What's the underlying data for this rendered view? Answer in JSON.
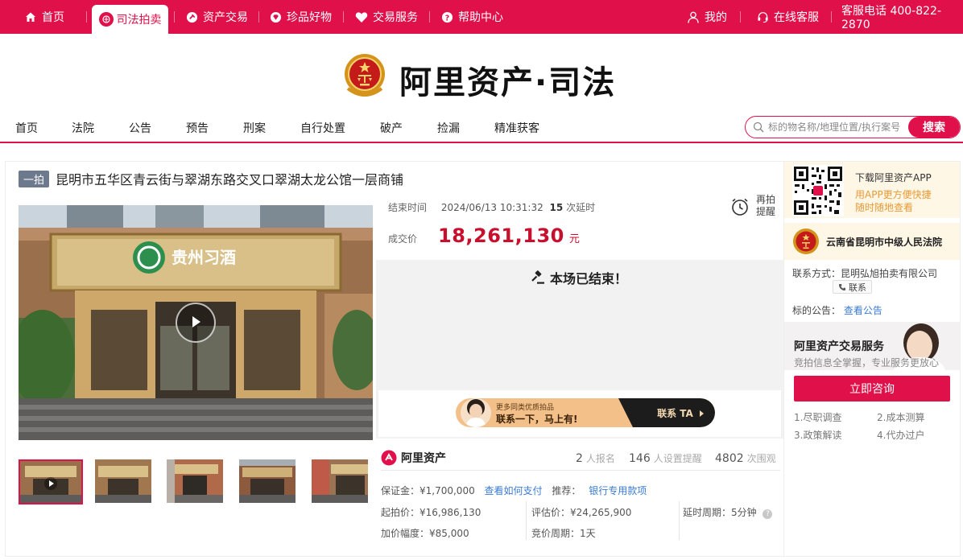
{
  "topbar": {
    "items": [
      {
        "label": "首页"
      },
      {
        "label": "司法拍卖"
      },
      {
        "label": "资产交易"
      },
      {
        "label": "珍品好物"
      },
      {
        "label": "交易服务"
      },
      {
        "label": "帮助中心"
      }
    ],
    "right": {
      "mine": "我的",
      "service": "在线客服",
      "hotline": "客服电话 400-822-2870"
    },
    "colors": {
      "brand": "#e0104a"
    }
  },
  "logo": {
    "text": "阿里资产·司法"
  },
  "subnav": {
    "items": [
      "首页",
      "法院",
      "公告",
      "预告",
      "刑案",
      "自行处置",
      "破产",
      "捡漏",
      "精准获客"
    ],
    "search_placeholder": "标的物名称/地理位置/执行案号",
    "search_button": "搜索"
  },
  "auction": {
    "tag": "一拍",
    "title": "昆明市五华区青云街与翠湖东路交叉口翠湖太龙公馆一层商铺",
    "end_time_label": "结束时间",
    "end_time": "2024/06/13 10:31:32",
    "delay_count": "15",
    "delay_suffix": "次延时",
    "remind_label_1": "再拍",
    "remind_label_2": "提醒",
    "deal_price_label": "成交价",
    "deal_price": "18,261,130",
    "deal_price_unit": "元",
    "ended_text": "本场已结束！",
    "shop_sign": "贵州习酒"
  },
  "ad": {
    "line1": "更多同类优质拍品",
    "line2": "联系一下，马上有!",
    "cta": "联系 TA"
  },
  "stats": {
    "brand": "阿里资产",
    "signup_count": "2",
    "signup_label": "人报名",
    "reminder_count": "146",
    "reminder_label": "人设置提醒",
    "view_count": "4802",
    "view_label": "次围观"
  },
  "details": {
    "deposit": "保证金：¥1,700,000",
    "deposit_link": "查看如何支付",
    "recommend_label": "推荐：",
    "recommend_link": "银行专用款项",
    "start_price": "起拍价：¥16,986,130",
    "appraisal": "评估价：¥24,265,900",
    "delay_period": "延时周期：5分钟",
    "increment": "加价幅度：¥85,000",
    "bid_period": "竞价周期：1天"
  },
  "side": {
    "app_title": "下载阿里资产APP",
    "app_sub1": "用APP更方便快捷",
    "app_sub2": "随时随地查看",
    "court_name": "云南省昆明市中级人民法院",
    "contact": "联系方式：昆明弘旭拍卖有限公司",
    "contact_btn": "联系",
    "notice_label": "标的公告：",
    "notice_link": "查看公告",
    "svc_title": "阿里资产交易服务",
    "svc_sub": "竞拍信息全掌握，专业服务更放心",
    "consult_btn": "立即咨询",
    "svc_items": [
      "1.尽职调查",
      "2.成本测算",
      "3.政策解读",
      "4.代办过户"
    ]
  }
}
